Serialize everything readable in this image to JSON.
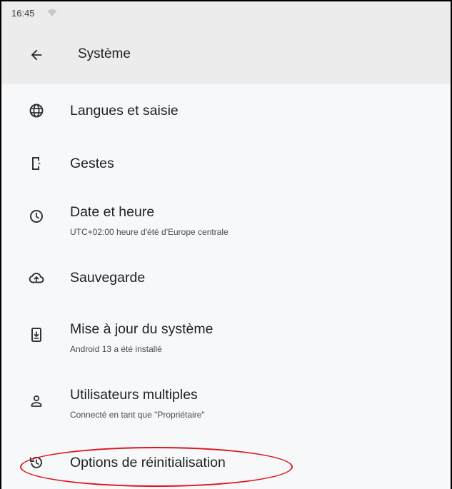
{
  "status_bar": {
    "time": "16:45",
    "wifi_icon": "wifi-icon"
  },
  "toolbar": {
    "back_icon": "arrow-back-icon",
    "title": "Système"
  },
  "settings": [
    {
      "icon": "globe-icon",
      "label": "Langues et saisie",
      "subtitle": ""
    },
    {
      "icon": "gesture-device-icon",
      "label": "Gestes",
      "subtitle": ""
    },
    {
      "icon": "clock-icon",
      "label": "Date et heure",
      "subtitle": "UTC+02:00 heure d'été d'Europe centrale"
    },
    {
      "icon": "cloud-upload-icon",
      "label": "Sauvegarde",
      "subtitle": ""
    },
    {
      "icon": "system-update-icon",
      "label": "Mise à jour du système",
      "subtitle": "Android 13 a été installé"
    },
    {
      "icon": "person-icon",
      "label": "Utilisateurs multiples",
      "subtitle": "Connecté en tant que \"Propriétaire\""
    },
    {
      "icon": "history-icon",
      "label": "Options de réinitialisation",
      "subtitle": ""
    }
  ],
  "annotation": {
    "highlight_color": "#e0141e"
  }
}
